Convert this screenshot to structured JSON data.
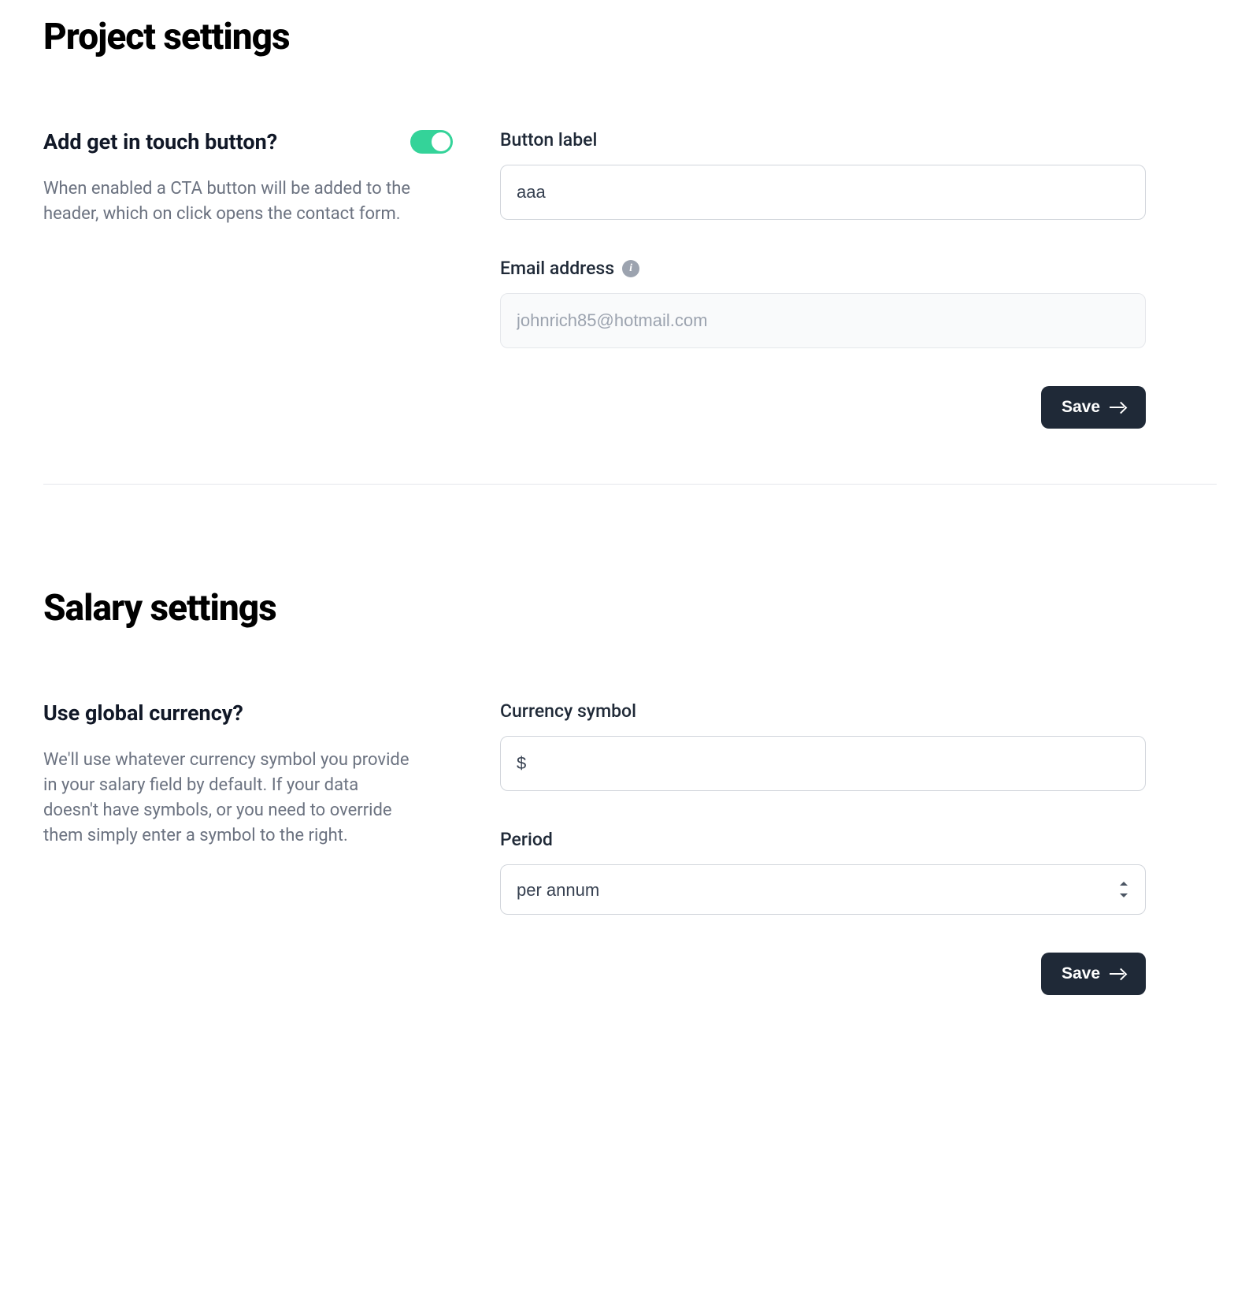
{
  "project": {
    "heading": "Project settings",
    "toggle_label": "Add get in touch button?",
    "toggle_on": true,
    "description": "When enabled a CTA button will be added to the header, which on click opens the contact form.",
    "button_label_field": {
      "label": "Button label",
      "value": "aaa"
    },
    "email_field": {
      "label": "Email address",
      "value": "johnrich85@hotmail.com"
    },
    "save_label": "Save"
  },
  "salary": {
    "heading": "Salary settings",
    "subhead": "Use global currency?",
    "description": "We'll use whatever currency symbol you provide in your salary field by default. If your data doesn't have symbols, or you need to override them simply enter a symbol to the right.",
    "currency_field": {
      "label": "Currency symbol",
      "value": "$"
    },
    "period_field": {
      "label": "Period",
      "value": "per annum"
    },
    "save_label": "Save"
  }
}
